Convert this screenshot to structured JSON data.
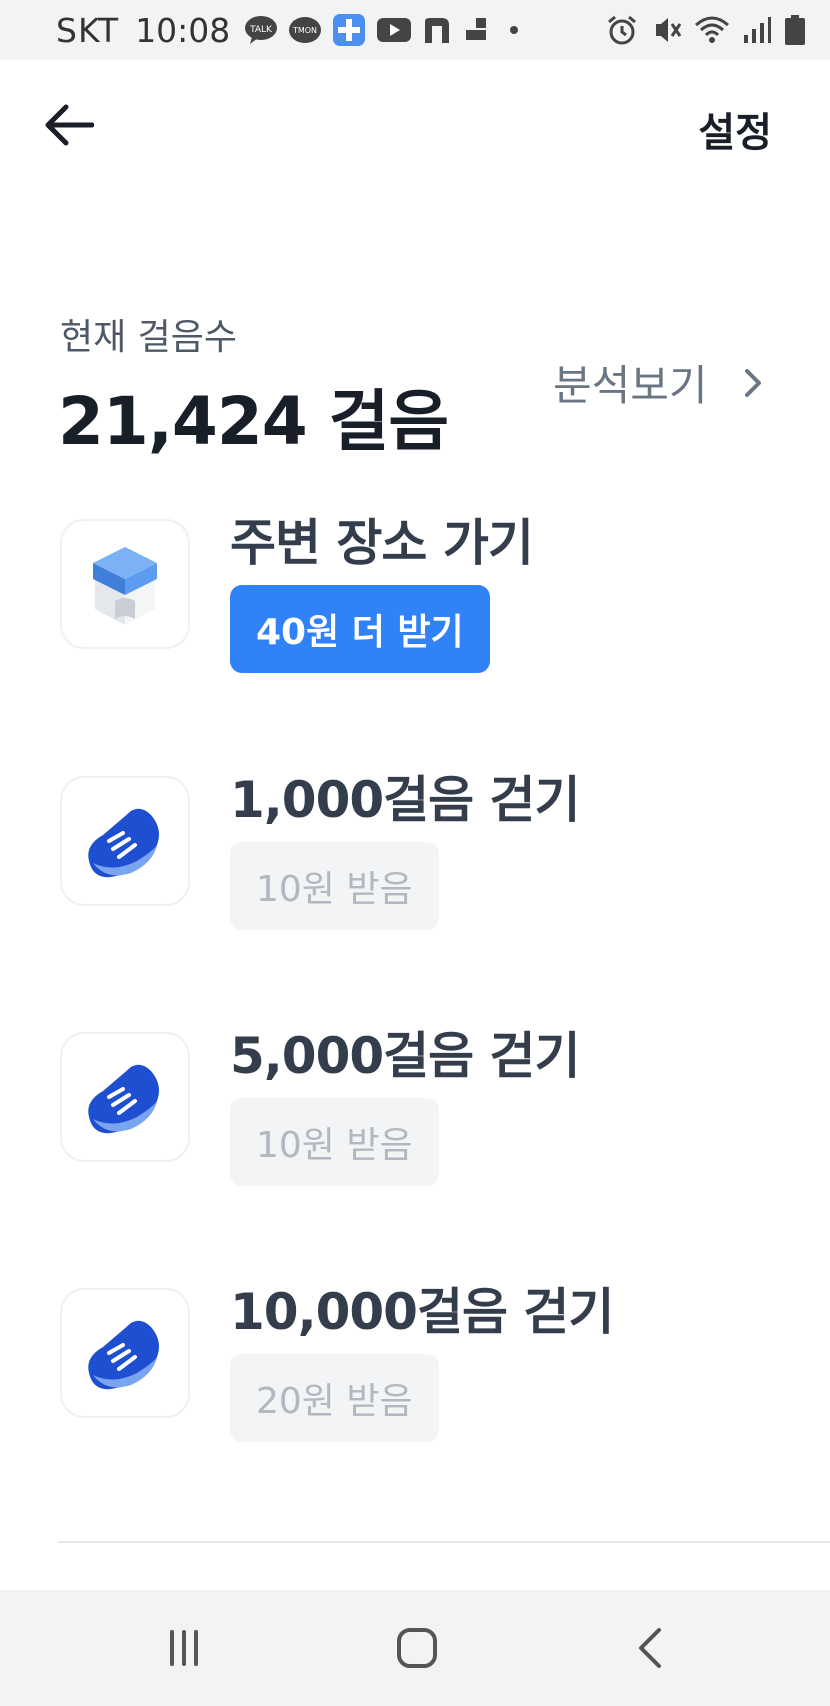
{
  "status_bar": {
    "carrier": "SKT",
    "time": "10:08",
    "left_icons": [
      "kakaotalk-icon",
      "tmon-icon",
      "plus-app-icon",
      "youtube-icon",
      "naver-icon",
      "app-icon",
      "dot-icon"
    ],
    "right_icons": [
      "alarm-icon",
      "vibrate-icon",
      "wifi-icon",
      "signal-icon",
      "battery-icon"
    ]
  },
  "header": {
    "back_icon": "arrow-left-icon",
    "settings_label": "설정"
  },
  "summary": {
    "label": "현재 걸음수",
    "value": "21,424 걸음",
    "analysis_label": "분석보기",
    "analysis_icon": "chevron-right-icon"
  },
  "missions": [
    {
      "title": "주변 장소 가기",
      "reward": "40원 더 받기",
      "status": "active",
      "icon": "place-marker-icon"
    },
    {
      "title": "1,000걸음 걷기",
      "reward": "10원 받음",
      "status": "done",
      "icon": "shoe-icon"
    },
    {
      "title": "5,000걸음 걷기",
      "reward": "10원 받음",
      "status": "done",
      "icon": "shoe-icon"
    },
    {
      "title": "10,000걸음 걷기",
      "reward": "20원 받음",
      "status": "done",
      "icon": "shoe-icon"
    }
  ],
  "colors": {
    "accent": "#3182f6",
    "disabled_bg": "#f2f4f6",
    "disabled_text": "#b0b8c1"
  },
  "nav_bar": {
    "icons": [
      "recent-apps-icon",
      "home-icon",
      "back-icon"
    ]
  }
}
